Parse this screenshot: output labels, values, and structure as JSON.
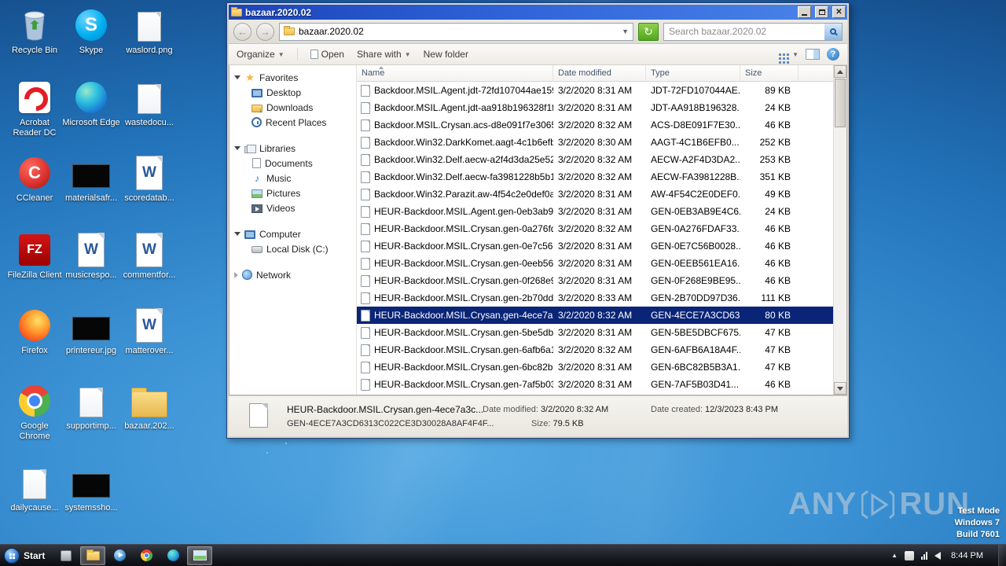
{
  "explorer": {
    "title": "bazaar.2020.02",
    "address": "bazaar.2020.02",
    "search_placeholder": "Search bazaar.2020.02",
    "toolbar": {
      "organize": "Organize",
      "open": "Open",
      "share_with": "Share with",
      "new_folder": "New folder"
    },
    "nav_pane": {
      "favorites_label": "Favorites",
      "favorites": [
        "Desktop",
        "Downloads",
        "Recent Places"
      ],
      "libraries_label": "Libraries",
      "libraries": [
        "Documents",
        "Music",
        "Pictures",
        "Videos"
      ],
      "computer_label": "Computer",
      "computer": [
        "Local Disk (C:)"
      ],
      "network_label": "Network"
    },
    "columns": {
      "name": "Name",
      "modified": "Date modified",
      "type": "Type",
      "size": "Size"
    },
    "files": [
      {
        "name": "Backdoor.MSIL.Agent.jdt-72fd107044ae159...",
        "modified": "3/2/2020 8:31 AM",
        "type": "JDT-72FD107044AE...",
        "size": "89 KB"
      },
      {
        "name": "Backdoor.MSIL.Agent.jdt-aa918b196328f1f...",
        "modified": "3/2/2020 8:31 AM",
        "type": "JDT-AA918B196328...",
        "size": "24 KB"
      },
      {
        "name": "Backdoor.MSIL.Crysan.acs-d8e091f7e30656...",
        "modified": "3/2/2020 8:32 AM",
        "type": "ACS-D8E091F7E30...",
        "size": "46 KB"
      },
      {
        "name": "Backdoor.Win32.DarkKomet.aagt-4c1b6efb...",
        "modified": "3/2/2020 8:30 AM",
        "type": "AAGT-4C1B6EFB0...",
        "size": "252 KB"
      },
      {
        "name": "Backdoor.Win32.Delf.aecw-a2f4d3da25e52d...",
        "modified": "3/2/2020 8:32 AM",
        "type": "AECW-A2F4D3DA2...",
        "size": "253 KB"
      },
      {
        "name": "Backdoor.Win32.Delf.aecw-fa3981228b5b12...",
        "modified": "3/2/2020 8:32 AM",
        "type": "AECW-FA3981228B...",
        "size": "351 KB"
      },
      {
        "name": "Backdoor.Win32.Parazit.aw-4f54c2e0def0a2...",
        "modified": "3/2/2020 8:31 AM",
        "type": "AW-4F54C2E0DEF0...",
        "size": "49 KB"
      },
      {
        "name": "HEUR-Backdoor.MSIL.Agent.gen-0eb3ab9e4...",
        "modified": "3/2/2020 8:31 AM",
        "type": "GEN-0EB3AB9E4C6...",
        "size": "24 KB"
      },
      {
        "name": "HEUR-Backdoor.MSIL.Crysan.gen-0a276fdaf...",
        "modified": "3/2/2020 8:32 AM",
        "type": "GEN-0A276FDAF33...",
        "size": "46 KB"
      },
      {
        "name": "HEUR-Backdoor.MSIL.Crysan.gen-0e7c56b0...",
        "modified": "3/2/2020 8:31 AM",
        "type": "GEN-0E7C56B0028...",
        "size": "46 KB"
      },
      {
        "name": "HEUR-Backdoor.MSIL.Crysan.gen-0eeb561e...",
        "modified": "3/2/2020 8:31 AM",
        "type": "GEN-0EEB561EA16...",
        "size": "46 KB"
      },
      {
        "name": "HEUR-Backdoor.MSIL.Crysan.gen-0f268e9b...",
        "modified": "3/2/2020 8:31 AM",
        "type": "GEN-0F268E9BE95...",
        "size": "46 KB"
      },
      {
        "name": "HEUR-Backdoor.MSIL.Crysan.gen-2b70dd97...",
        "modified": "3/2/2020 8:33 AM",
        "type": "GEN-2B70DD97D36...",
        "size": "111 KB"
      },
      {
        "name": "HEUR-Backdoor.MSIL.Crysan.gen-4ece7a3c...",
        "modified": "3/2/2020 8:32 AM",
        "type": "GEN-4ECE7A3CD63...",
        "size": "80 KB",
        "selected": true
      },
      {
        "name": "HEUR-Backdoor.MSIL.Crysan.gen-5be5dbcf...",
        "modified": "3/2/2020 8:31 AM",
        "type": "GEN-5BE5DBCF675...",
        "size": "47 KB"
      },
      {
        "name": "HEUR-Backdoor.MSIL.Crysan.gen-6afb6a18...",
        "modified": "3/2/2020 8:32 AM",
        "type": "GEN-6AFB6A18A4F...",
        "size": "47 KB"
      },
      {
        "name": "HEUR-Backdoor.MSIL.Crysan.gen-6bc82b5b...",
        "modified": "3/2/2020 8:31 AM",
        "type": "GEN-6BC82B5B3A1...",
        "size": "47 KB"
      },
      {
        "name": "HEUR-Backdoor.MSIL.Crysan.gen-7af5b03d...",
        "modified": "3/2/2020 8:31 AM",
        "type": "GEN-7AF5B03D41...",
        "size": "46 KB"
      }
    ],
    "details": {
      "name": "HEUR-Backdoor.MSIL.Crysan.gen-4ece7a3c...",
      "modified_label": "Date modified:",
      "modified": "3/2/2020 8:32 AM",
      "created_label": "Date created:",
      "created": "12/3/2023 8:43 PM",
      "hash": "GEN-4ECE7A3CD6313C022CE3D30028A8AF4F4F...",
      "size_label": "Size:",
      "size": "79.5 KB"
    }
  },
  "desktop": {
    "icons": [
      {
        "label": "Recycle Bin"
      },
      {
        "label": "Skype"
      },
      {
        "label": "waslord.png"
      },
      {
        "label": "Acrobat Reader DC"
      },
      {
        "label": "Microsoft Edge"
      },
      {
        "label": "wastedocu..."
      },
      {
        "label": "CCleaner"
      },
      {
        "label": "materialsafr..."
      },
      {
        "label": "scoredatab..."
      },
      {
        "label": "FileZilla Client"
      },
      {
        "label": "musicrespo..."
      },
      {
        "label": "commentfor..."
      },
      {
        "label": "Firefox"
      },
      {
        "label": "printereur.jpg"
      },
      {
        "label": "matterover..."
      },
      {
        "label": "Google Chrome"
      },
      {
        "label": "supportimp..."
      },
      {
        "label": "bazaar.202..."
      },
      {
        "label": "dailycause..."
      },
      {
        "label": "systemssho..."
      }
    ]
  },
  "taskbar": {
    "start_label": "Start",
    "clock": "8:44 PM"
  },
  "watermark": {
    "any": "ANY",
    "run": "RUN",
    "mode": "Test Mode",
    "os": "Windows 7",
    "build": "Build 7601"
  }
}
